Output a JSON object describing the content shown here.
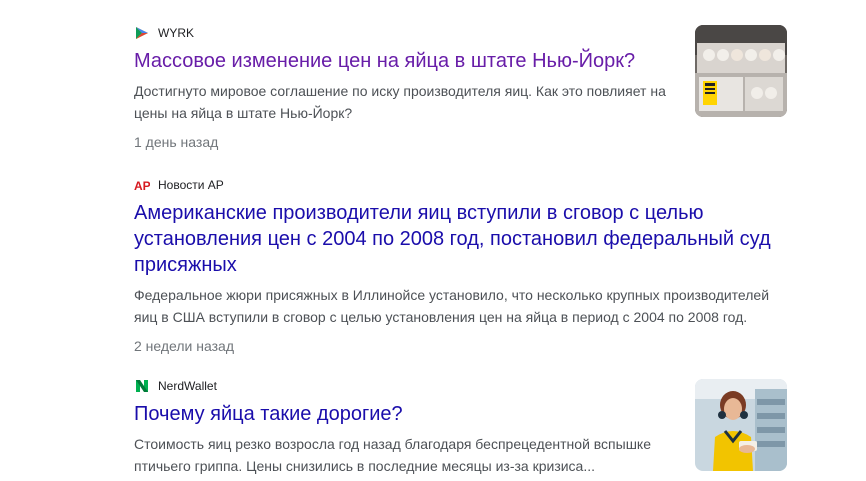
{
  "articles": [
    {
      "source": "WYRK",
      "source_icon": "wyrk-logo-icon",
      "title": "Массовое изменение цен на яйца в штате Нью-Йорк?",
      "snippet": "Достигнуто мировое соглашение по иску производителя яиц. Как это повлияет на цены на яйца в штате Нью-Йорк?",
      "age": "1 день назад",
      "visited": true,
      "thumbnail": "egg-cartons-image"
    },
    {
      "source": "Новости AP",
      "source_icon": "ap-logo-icon",
      "title": "Американские производители яиц вступили в сговор с целью установления цен с 2004 по 2008 год, постановил федеральный суд присяжных",
      "snippet": "Федеральное жюри присяжных в Иллинойсе установило, что несколько крупных производителей яиц в США вступили в сговор с целью установления цен на яйца в период с 2004 по 2008 год.",
      "age": "2 недели назад",
      "visited": false,
      "thumbnail": null
    },
    {
      "source": "NerdWallet",
      "source_icon": "nerdwallet-logo-icon",
      "title": "Почему яйца такие дорогие?",
      "snippet": "Стоимость яиц резко возросла год назад благодаря беспрецедентной вспышке птичьего гриппа. Цены снизились в последние месяцы из-за кризиса...",
      "age": "",
      "visited": false,
      "thumbnail": "woman-shopping-image"
    }
  ],
  "colors": {
    "link": "#1a0dab",
    "visited_link": "#681da8",
    "snippet": "#4d5156",
    "meta": "#70757a",
    "ap_red": "#d71920",
    "nerdwallet_green": "#00b050"
  }
}
